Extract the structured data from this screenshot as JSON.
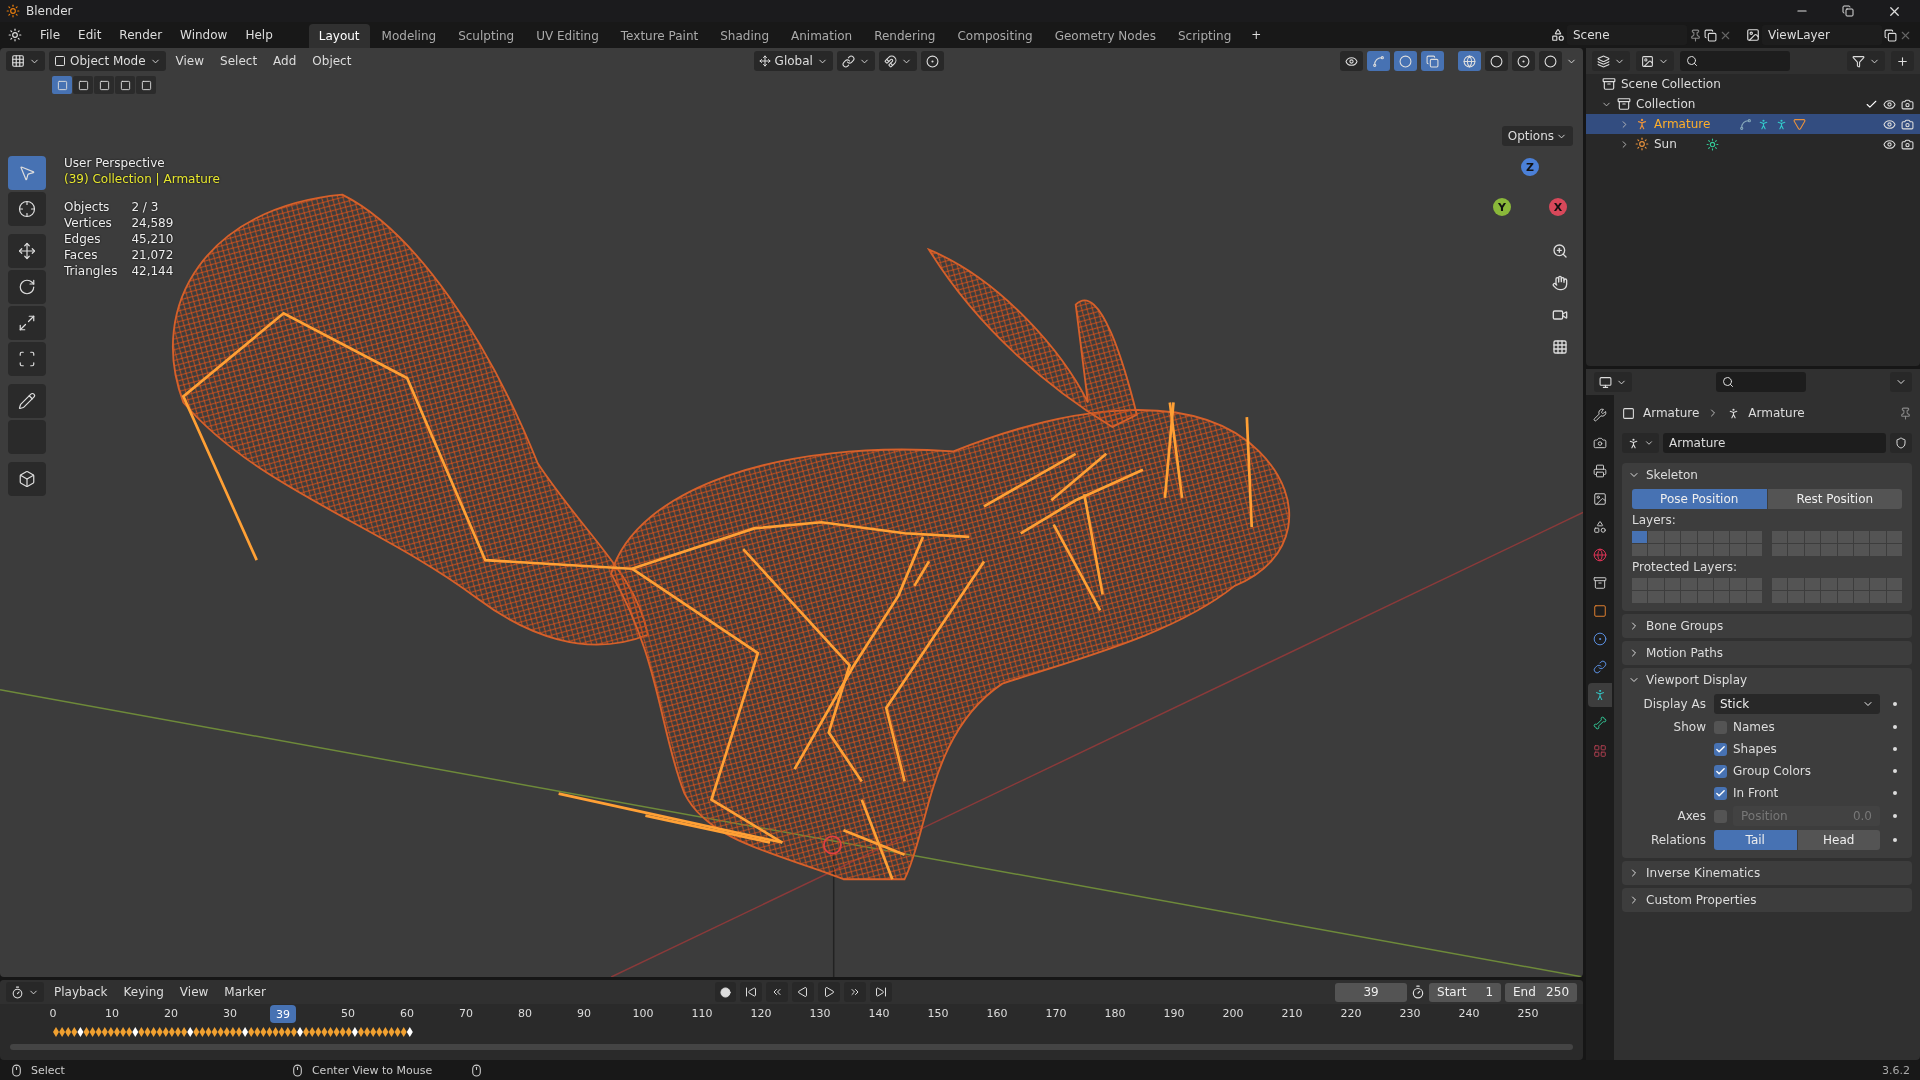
{
  "window": {
    "title": "Blender"
  },
  "menu": [
    "File",
    "Edit",
    "Render",
    "Window",
    "Help"
  ],
  "workspaces": [
    {
      "label": "Layout",
      "selected": true
    },
    {
      "label": "Modeling",
      "selected": false
    },
    {
      "label": "Sculpting",
      "selected": false
    },
    {
      "label": "UV Editing",
      "selected": false
    },
    {
      "label": "Texture Paint",
      "selected": false
    },
    {
      "label": "Shading",
      "selected": false
    },
    {
      "label": "Animation",
      "selected": false
    },
    {
      "label": "Rendering",
      "selected": false
    },
    {
      "label": "Compositing",
      "selected": false
    },
    {
      "label": "Geometry Nodes",
      "selected": false
    },
    {
      "label": "Scripting",
      "selected": false
    }
  ],
  "add_workspace": "+",
  "scene": "Scene",
  "view_layer": "ViewLayer",
  "viewport_header": {
    "mode": "Object Mode",
    "menus": [
      "View",
      "Select",
      "Add",
      "Object"
    ],
    "orientation": "Global",
    "options": "Options"
  },
  "select_modes": [
    {
      "selected": true
    },
    {
      "selected": false
    },
    {
      "selected": false
    },
    {
      "selected": false
    },
    {
      "selected": false
    }
  ],
  "viewport_toggles": [
    {
      "on": false
    },
    {
      "on": true
    },
    {
      "on": true
    },
    {
      "on": true
    }
  ],
  "shading_modes": [
    {
      "selected": true
    },
    {
      "selected": false
    },
    {
      "selected": false
    },
    {
      "selected": false
    }
  ],
  "tools": [
    {
      "selected": true
    },
    {
      "selected": false
    },
    {
      "selected": false
    },
    {
      "selected": false
    },
    {
      "selected": false
    },
    {
      "selected": false
    },
    {
      "selected": false
    },
    {
      "selected": false
    },
    {
      "selected": false
    }
  ],
  "overlay": {
    "view": "User Perspective",
    "context": "(39) Collection | Armature",
    "stats": [
      {
        "label": "Objects",
        "value": "2 / 3"
      },
      {
        "label": "Vertices",
        "value": "24,589"
      },
      {
        "label": "Edges",
        "value": "45,210"
      },
      {
        "label": "Faces",
        "value": "21,072"
      },
      {
        "label": "Triangles",
        "value": "42,144"
      }
    ]
  },
  "gizmo": [
    {
      "label": "Z"
    },
    {
      "label": "Y"
    },
    {
      "label": "X"
    }
  ],
  "outliner": {
    "root": "Scene Collection",
    "items": [
      {
        "label": "Collection",
        "kind": "collection",
        "expanded": true,
        "selected": false,
        "children": [
          {
            "label": "Armature",
            "kind": "armature",
            "expanded": false,
            "selected": true
          },
          {
            "label": "Sun",
            "kind": "light",
            "expanded": false,
            "selected": false
          }
        ]
      }
    ]
  },
  "properties": {
    "tabs": [
      {
        "selected": false
      },
      {
        "selected": false
      },
      {
        "selected": false
      },
      {
        "selected": false
      },
      {
        "selected": false
      },
      {
        "selected": false
      },
      {
        "selected": false
      },
      {
        "selected": false
      },
      {
        "selected": false
      },
      {
        "selected": false
      },
      {
        "selected": true
      },
      {
        "selected": false
      },
      {
        "selected": false
      }
    ],
    "breadcrumb": [
      "Armature",
      "Armature"
    ],
    "data_name": "Armature",
    "panels": [
      {
        "title": "Skeleton",
        "expanded": true,
        "skeleton": {
          "positions": [
            {
              "label": "Pose Position",
              "selected": true
            },
            {
              "label": "Rest Position",
              "selected": false
            }
          ],
          "layers_label": "Layers:",
          "protected_label": "Protected Layers:"
        }
      },
      {
        "title": "Bone Groups",
        "expanded": false
      },
      {
        "title": "Motion Paths",
        "expanded": false
      },
      {
        "title": "Viewport Display",
        "expanded": true,
        "display": {
          "display_as_label": "Display As",
          "display_as": "Stick",
          "show_label": "Show",
          "show": [
            {
              "label": "Names",
              "checked": false
            },
            {
              "label": "Shapes",
              "checked": true
            },
            {
              "label": "Group Colors",
              "checked": true
            },
            {
              "label": "In Front",
              "checked": true
            }
          ],
          "axes_label": "Axes",
          "axes_checked": false,
          "axes_position": "Position",
          "axes_value": "0.0",
          "relations_label": "Relations",
          "relations": [
            {
              "label": "Tail",
              "selected": true
            },
            {
              "label": "Head",
              "selected": false
            }
          ]
        }
      },
      {
        "title": "Inverse Kinematics",
        "expanded": false
      },
      {
        "title": "Custom Properties",
        "expanded": false
      }
    ]
  },
  "timeline": {
    "menus": [
      "Playback",
      "Keying",
      "View",
      "Marker"
    ],
    "current": "39",
    "start_label": "Start",
    "start": "1",
    "end_label": "End",
    "end": "250",
    "playhead": "39",
    "ticks": [
      "0",
      "10",
      "20",
      "30",
      "50",
      "60",
      "70",
      "80",
      "90",
      "100",
      "110",
      "120",
      "130",
      "140",
      "150",
      "160",
      "170",
      "180",
      "190",
      "200",
      "210",
      "220",
      "230",
      "240",
      "250"
    ]
  },
  "status": {
    "items": [
      "Select",
      "Center View to Mouse"
    ],
    "version": "3.6.2"
  }
}
